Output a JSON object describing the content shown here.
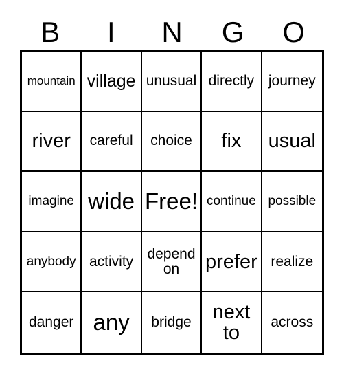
{
  "card": {
    "title": "BINGO",
    "headers": [
      "B",
      "I",
      "N",
      "G",
      "O"
    ],
    "free_space_label": "Free!",
    "free_space_position": {
      "row": 3,
      "col": 3
    },
    "rows": [
      [
        {
          "text": "mountain",
          "size": "xs"
        },
        {
          "text": "village",
          "size": "lg"
        },
        {
          "text": "unusual",
          "size": "md"
        },
        {
          "text": "directly",
          "size": "md"
        },
        {
          "text": "journey",
          "size": "md"
        }
      ],
      [
        {
          "text": "river",
          "size": "xl"
        },
        {
          "text": "careful",
          "size": "md"
        },
        {
          "text": "choice",
          "size": "md"
        },
        {
          "text": "fix",
          "size": "xl"
        },
        {
          "text": "usual",
          "size": "xl"
        }
      ],
      [
        {
          "text": "imagine",
          "size": "sm"
        },
        {
          "text": "wide",
          "size": "xxl"
        },
        {
          "text": "Free!",
          "size": "xxl"
        },
        {
          "text": "continue",
          "size": "sm"
        },
        {
          "text": "possible",
          "size": "sm"
        }
      ],
      [
        {
          "text": "anybody",
          "size": "sm"
        },
        {
          "text": "activity",
          "size": "md"
        },
        {
          "text": "depend on",
          "size": "md"
        },
        {
          "text": "prefer",
          "size": "xl"
        },
        {
          "text": "realize",
          "size": "md"
        }
      ],
      [
        {
          "text": "danger",
          "size": "md"
        },
        {
          "text": "any",
          "size": "xxl"
        },
        {
          "text": "bridge",
          "size": "md"
        },
        {
          "text": "next to",
          "size": "xl"
        },
        {
          "text": "across",
          "size": "md"
        }
      ]
    ]
  },
  "colors": {
    "background": "#ffffff",
    "text": "#000000",
    "grid_line": "#000000",
    "outer_border": "#000000"
  }
}
